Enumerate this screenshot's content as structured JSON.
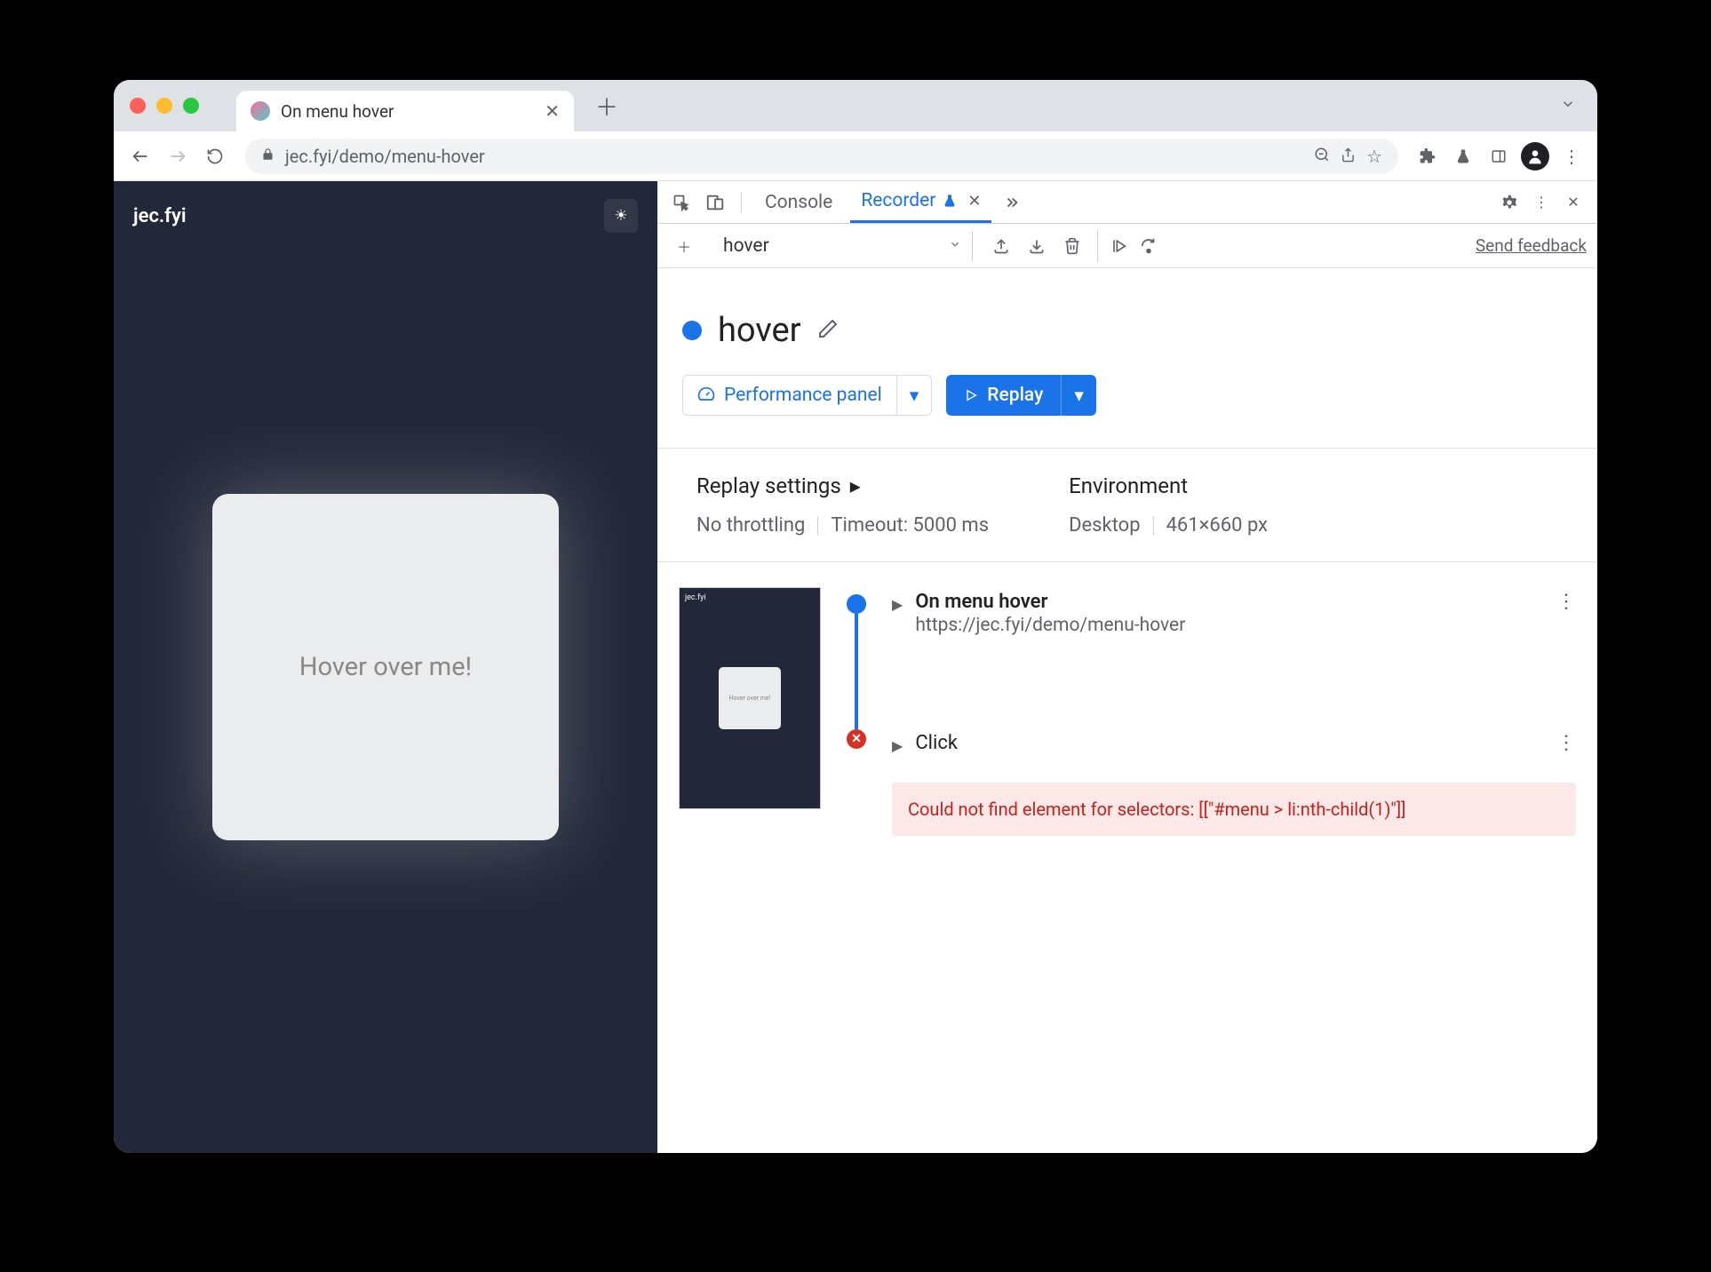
{
  "browser": {
    "tab_title": "On menu hover",
    "url": "jec.fyi/demo/menu-hover"
  },
  "page": {
    "site_title": "jec.fyi",
    "card_text": "Hover over me!"
  },
  "devtools": {
    "tabs": {
      "console": "Console",
      "recorder": "Recorder"
    },
    "recorder": {
      "selected_recording": "hover",
      "feedback": "Send feedback",
      "name": "hover",
      "perf_button": "Performance panel",
      "replay_button": "Replay",
      "settings": {
        "replay_heading": "Replay settings",
        "throttling": "No throttling",
        "timeout": "Timeout: 5000 ms",
        "env_heading": "Environment",
        "device": "Desktop",
        "viewport": "461×660 px"
      },
      "steps": {
        "step1_name": "On menu hover",
        "step1_url": "https://jec.fyi/demo/menu-hover",
        "step2_name": "Click",
        "error_text": "Could not find element for selectors: [[\"#menu > li:nth-child(1)\"]]"
      },
      "thumbnail": {
        "header": "jec.fyi",
        "card": "Hover over me!"
      }
    }
  }
}
